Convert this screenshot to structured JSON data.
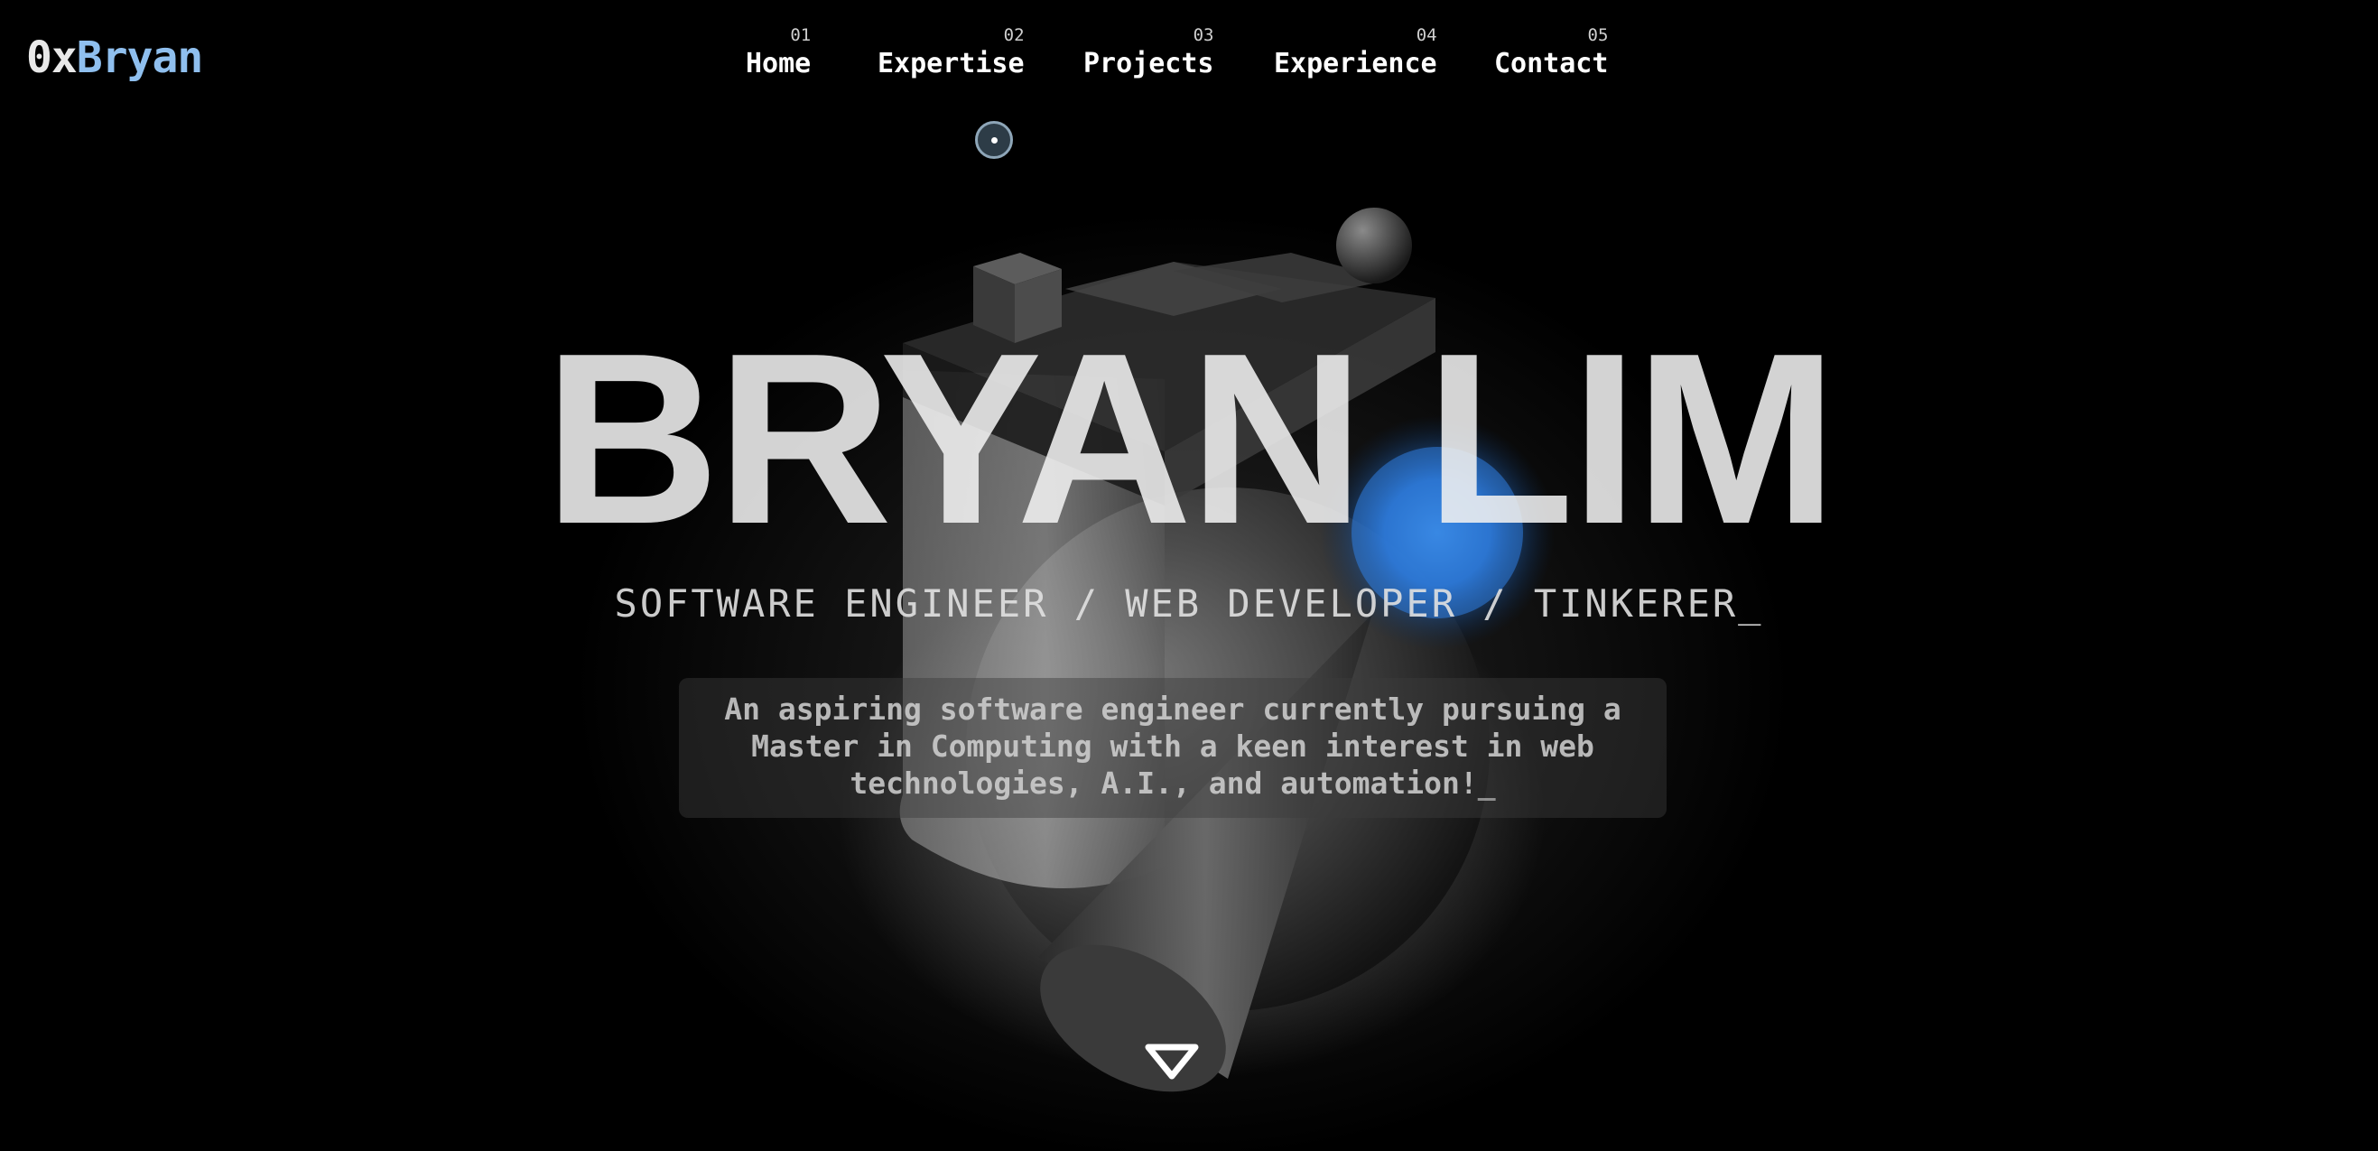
{
  "logo": {
    "prefix": "0x",
    "name": "Bryan"
  },
  "nav": {
    "items": [
      {
        "num": "01",
        "label": "Home"
      },
      {
        "num": "02",
        "label": "Expertise"
      },
      {
        "num": "03",
        "label": "Projects"
      },
      {
        "num": "04",
        "label": "Experience"
      },
      {
        "num": "05",
        "label": "Contact"
      }
    ]
  },
  "hero": {
    "title": "BRYAN LIM",
    "subtitle": "SOFTWARE ENGINEER / WEB DEVELOPER / TINKERER_",
    "description": "An aspiring software engineer currently pursuing a Master in Computing with a keen interest in web technologies, A.I., and automation!",
    "caret": "_"
  },
  "icons": {
    "cursor": "cursor-dot-icon",
    "scroll": "chevron-down-icon"
  },
  "colors": {
    "background": "#000000",
    "logo_accent": "#8fbfee",
    "glow_accent": "#3d8ff0"
  }
}
